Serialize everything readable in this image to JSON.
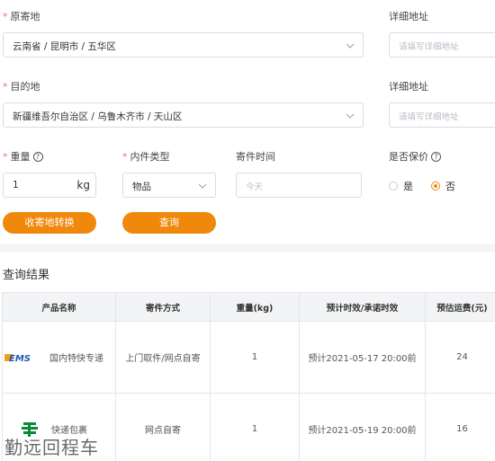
{
  "origin": {
    "label": "原寄地",
    "value": "云南省 / 昆明市 / 五华区",
    "detail_label": "详细地址",
    "detail_placeholder": "请填写详细地址"
  },
  "destination": {
    "label": "目的地",
    "value": "新疆维吾尔自治区 / 乌鲁木齐市 / 天山区",
    "detail_label": "详细地址",
    "detail_placeholder": "请填写详细地址"
  },
  "weight": {
    "label": "重量",
    "value": "1",
    "unit": "kg"
  },
  "item_type": {
    "label": "内件类型",
    "value": "物品"
  },
  "send_time": {
    "label": "寄件时间",
    "placeholder": "今天"
  },
  "insurance": {
    "label": "是否保价",
    "yes": "是",
    "no": "否",
    "selected": "否"
  },
  "buttons": {
    "swap": "收寄地转换",
    "query": "查询"
  },
  "results": {
    "title": "查询结果",
    "headers": [
      "产品名称",
      "寄件方式",
      "重量(kg)",
      "预计时效/承诺时效",
      "预估运费(元)"
    ],
    "rows": [
      {
        "logo": "EMS",
        "product": "国内特快专递",
        "method": "上门取件/网点自寄",
        "weight": "1",
        "eta": "预计2021-05-17 20:00前",
        "fee": "24"
      },
      {
        "logo": "china-post-icon",
        "product": "快递包裹",
        "method": "网点自寄",
        "weight": "1",
        "eta": "预计2021-05-19 20:00前",
        "fee": "16"
      }
    ]
  },
  "watermark": "勤远回程车",
  "colors": {
    "accent": "#f0880c",
    "required": "#f56c6c"
  }
}
